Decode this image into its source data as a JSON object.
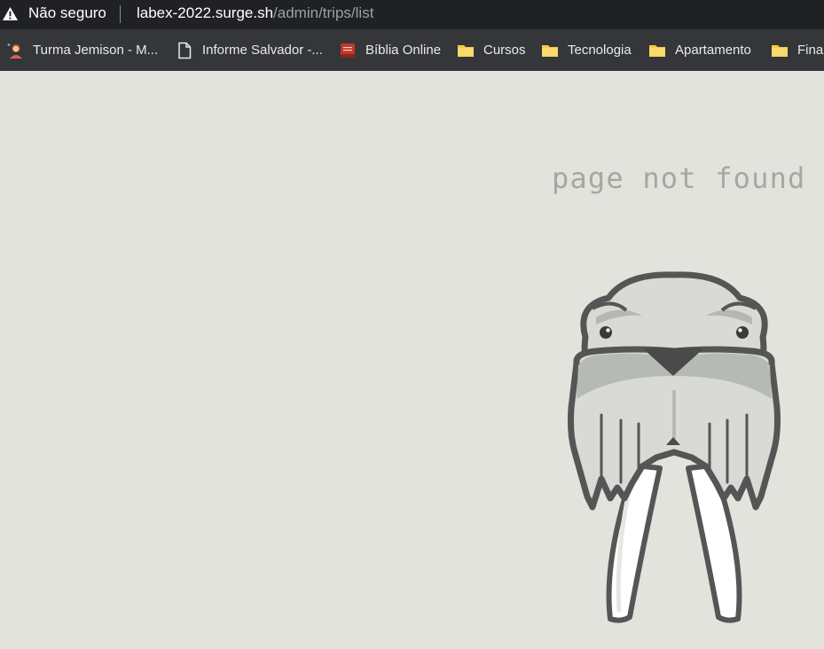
{
  "address_bar": {
    "security_text": "Não seguro",
    "url_host": "labex-2022.surge.sh",
    "url_path": "/admin/trips/list"
  },
  "bookmarks": [
    {
      "label": "Turma Jemison - M...",
      "icon": "avatar-icon"
    },
    {
      "label": "Informe Salvador -...",
      "icon": "page-icon"
    },
    {
      "label": "Bíblia Online",
      "icon": "bible-icon"
    },
    {
      "label": "Cursos",
      "icon": "folder-icon"
    },
    {
      "label": "Tecnologia",
      "icon": "folder-icon"
    },
    {
      "label": "Apartamento",
      "icon": "folder-icon"
    },
    {
      "label": "Finar",
      "icon": "folder-icon"
    }
  ],
  "page": {
    "message": "page not found"
  },
  "colors": {
    "background": "#e3e3de",
    "message": "#a7a7a2",
    "folder": "#f7c948",
    "outline": "#555555"
  }
}
